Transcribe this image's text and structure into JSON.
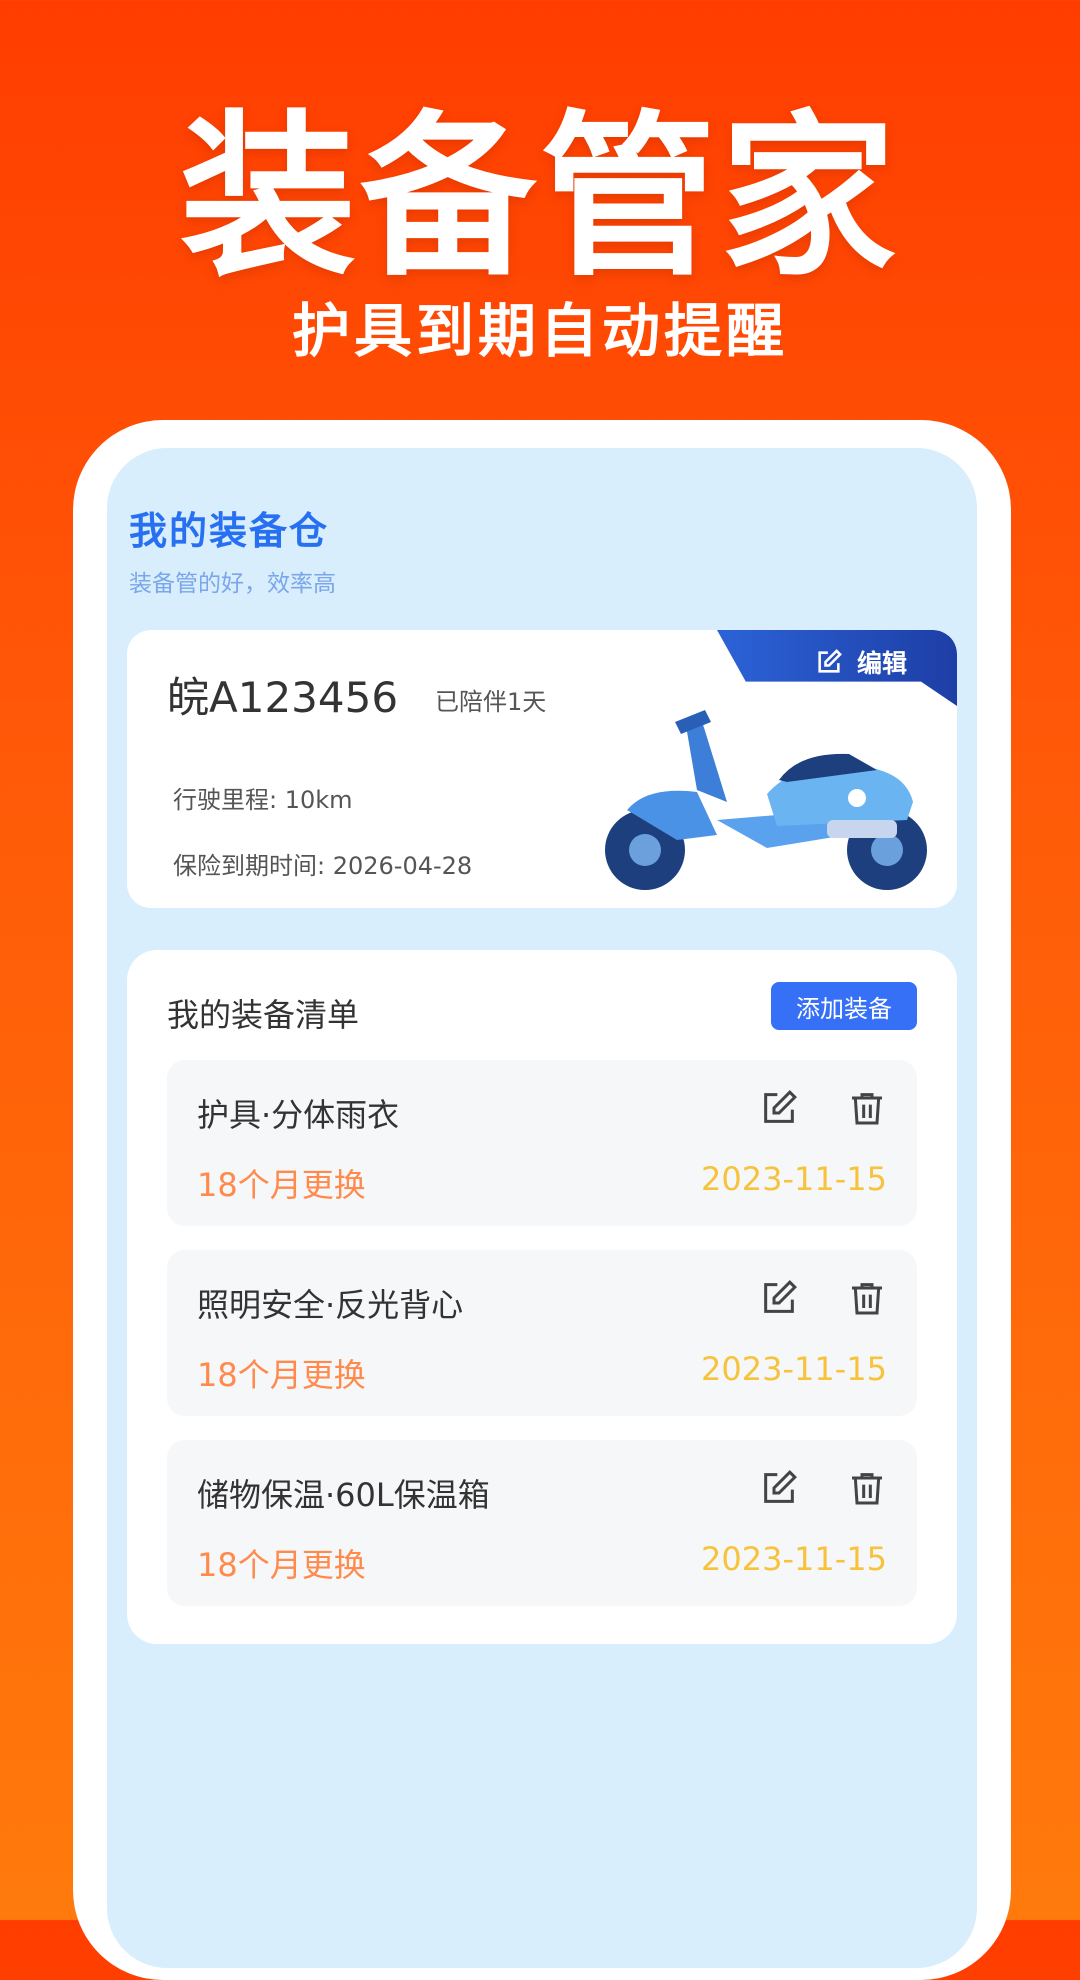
{
  "hero": {
    "title": "装备管家",
    "subtitle": "护具到期自动提醒"
  },
  "screen": {
    "title": "我的装备仓",
    "subtitle": "装备管的好，效率高"
  },
  "vehicle": {
    "plate": "皖A123456",
    "companion": "已陪伴1天",
    "edit_label": "编辑",
    "mileage": "行驶里程: 10km",
    "insurance": "保险到期时间: 2026-04-28"
  },
  "equipment": {
    "title": "我的装备清单",
    "add_label": "添加装备",
    "items": [
      {
        "name": "护具·分体雨衣",
        "cycle": "18个月更换",
        "date": "2023-11-15"
      },
      {
        "name": "照明安全·反光背心",
        "cycle": "18个月更换",
        "date": "2023-11-15"
      },
      {
        "name": "储物保温·60L保温箱",
        "cycle": "18个月更换",
        "date": "2023-11-15"
      }
    ]
  },
  "colors": {
    "accent_blue": "#2870f2",
    "cycle_orange": "#ff8a4c",
    "date_yellow": "#f7c33d",
    "background_orange": "#ff5a08"
  }
}
